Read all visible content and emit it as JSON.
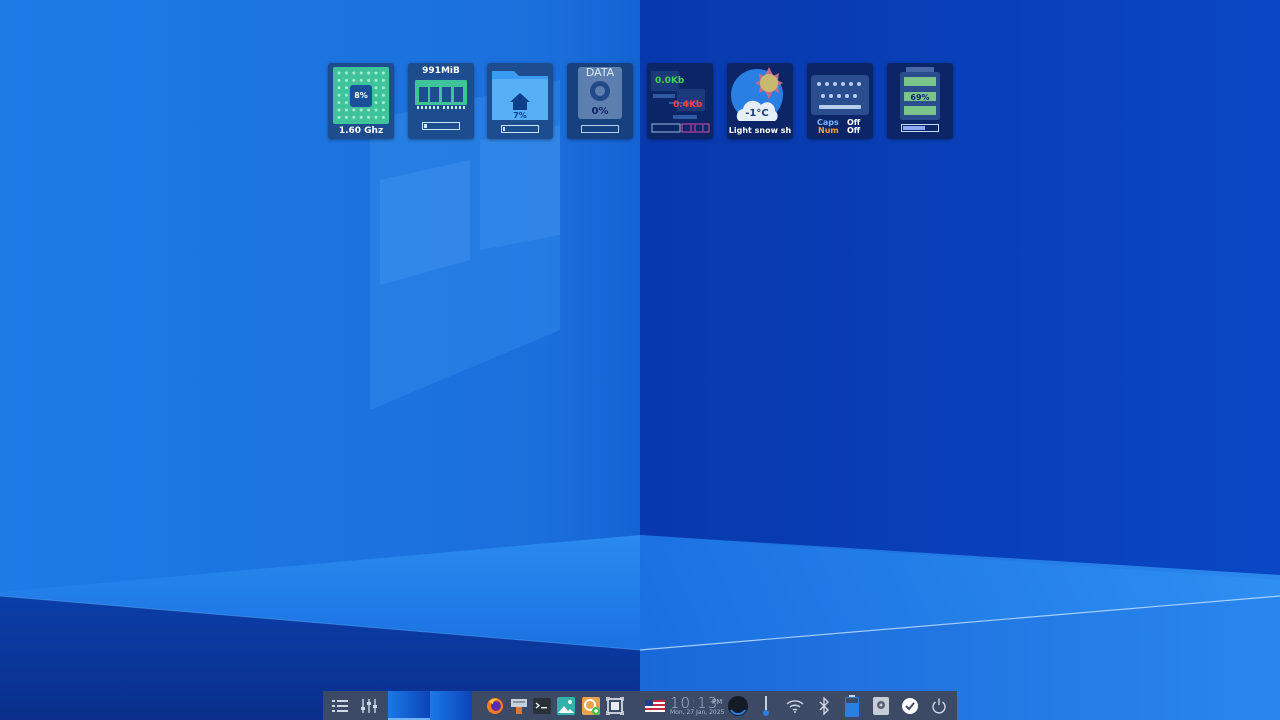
{
  "desktop": {
    "widgets": {
      "cpu": {
        "usage": "8%",
        "frequency": "1.60 Ghz"
      },
      "memory": {
        "used": "991MiB",
        "usage_fraction": 0.08
      },
      "home": {
        "usage": "7%",
        "usage_fraction": 0.07
      },
      "data_drive": {
        "name": "DATA",
        "usage": "0%",
        "usage_fraction": 0.0
      },
      "network": {
        "download": "0.0Kb",
        "upload": "0.4Kb"
      },
      "weather": {
        "temperature": "-1°C",
        "condition": "Light snow sh"
      },
      "lock_keys": {
        "caps_label": "Caps",
        "caps_state": "Off",
        "num_label": "Num",
        "num_state": "Off"
      },
      "battery": {
        "level": "69%",
        "level_fraction": 0.69
      }
    }
  },
  "taskbar": {
    "left_icons": [
      "menu-list-icon",
      "mixer-sliders-icon"
    ],
    "workspaces": [
      {
        "name": "workspace-1",
        "active": true
      },
      {
        "name": "workspace-2",
        "active": false
      }
    ],
    "launchers": [
      "firefox-icon",
      "file-cabinet-icon",
      "terminal-icon",
      "image-viewer-icon",
      "screenshot-icon",
      "screen-capture-icon"
    ],
    "keyboard_layout_icon": "us-flag-icon",
    "clock": {
      "time_h": "10",
      "time_m": "13",
      "ampm": "PM",
      "date": "Mon, 27 Jan, 2025"
    },
    "tray_icons": [
      "audio-icon",
      "brightness-icon",
      "wifi-icon",
      "bluetooth-icon",
      "battery-icon",
      "disk-icon",
      "updates-check-icon",
      "power-icon"
    ]
  },
  "colors": {
    "wallpaper_left": "#1670e0",
    "wallpaper_right": "#0a3ab8",
    "cpu_green": "#3ec39a",
    "widget_dark": "#0b2566",
    "net_download": "#3fd24e",
    "net_upload": "#ff4040",
    "caps_color": "#7fb6ff",
    "num_color": "#ff9f2e",
    "taskbar_bg": "#3c4a66"
  }
}
